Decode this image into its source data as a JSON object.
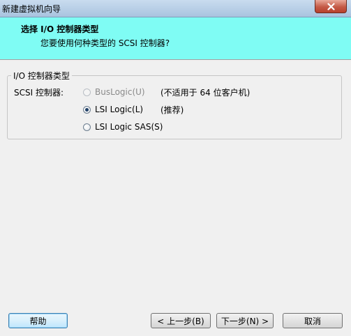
{
  "window": {
    "title": "新建虚拟机向导",
    "close_icon": "close-icon"
  },
  "header": {
    "heading": "选择 I/O 控制器类型",
    "subheading": "您要使用何种类型的 SCSI 控制器?"
  },
  "group": {
    "title": "I/O 控制器类型",
    "row_label": "SCSI 控制器:",
    "options": [
      {
        "label": "BusLogic(U)",
        "note": "(不适用于 64 位客户机)",
        "checked": false,
        "enabled": false
      },
      {
        "label": "LSI Logic(L)",
        "note": "(推荐)",
        "checked": true,
        "enabled": true
      },
      {
        "label": "LSI Logic SAS(S)",
        "note": "",
        "checked": false,
        "enabled": true
      }
    ]
  },
  "buttons": {
    "help": "帮助",
    "back": "< 上一步(B)",
    "next": "下一步(N) >",
    "cancel": "取消"
  },
  "colors": {
    "header_bg": "#7ffcf4",
    "window_bg": "#f0f0f0"
  }
}
